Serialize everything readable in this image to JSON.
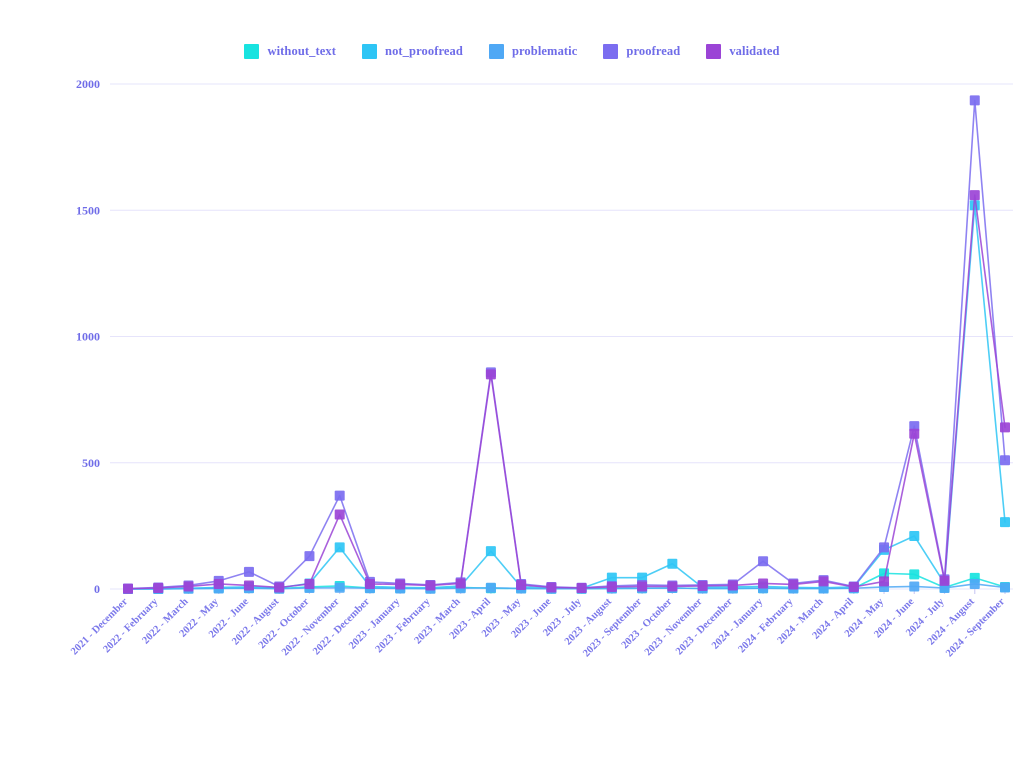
{
  "chart_data": {
    "type": "line",
    "title": "",
    "xlabel": "",
    "ylabel": "",
    "ylim": [
      0,
      2000
    ],
    "yticks": [
      0,
      500,
      1000,
      1500,
      2000
    ],
    "ytick_labels": [
      "0",
      "500",
      "1000",
      "1500",
      "2000"
    ],
    "grid": true,
    "legend_position": "top-center",
    "markers": "square",
    "categories": [
      "2021 - December",
      "2022 - February",
      "2022 - March",
      "2022 - May",
      "2022 - June",
      "2022 - August",
      "2022 - October",
      "2022 - November",
      "2022 - December",
      "2023 - January",
      "2023 - February",
      "2023 - March",
      "2023 - April",
      "2023 - May",
      "2023 - June",
      "2023 - July",
      "2023 - August",
      "2023 - September",
      "2023 - October",
      "2023 - November",
      "2023 - December",
      "2024 - January",
      "2024 - February",
      "2024 - March",
      "2024 - April",
      "2024 - May",
      "2024 - June",
      "2024 - July",
      "2024 - August",
      "2024 - September"
    ],
    "series": [
      {
        "name": "without_text",
        "color": "#18e3e0",
        "values": [
          0,
          0,
          2,
          3,
          4,
          2,
          8,
          12,
          4,
          3,
          2,
          6,
          3,
          2,
          1,
          1,
          2,
          3,
          4,
          2,
          2,
          3,
          2,
          2,
          3,
          62,
          58,
          6,
          44,
          8
        ]
      },
      {
        "name": "not_proofread",
        "color": "#2ec5f5",
        "values": [
          0,
          1,
          3,
          6,
          8,
          5,
          22,
          165,
          10,
          6,
          5,
          12,
          150,
          8,
          4,
          3,
          45,
          45,
          100,
          6,
          8,
          10,
          6,
          5,
          8,
          155,
          210,
          22,
          1520,
          265
        ]
      },
      {
        "name": "problematic",
        "color": "#4fa8f5",
        "values": [
          0,
          0,
          1,
          2,
          3,
          1,
          4,
          5,
          3,
          2,
          1,
          3,
          5,
          2,
          1,
          1,
          2,
          3,
          4,
          2,
          2,
          3,
          2,
          2,
          3,
          8,
          10,
          4,
          20,
          6
        ]
      },
      {
        "name": "proofread",
        "color": "#7b6df0",
        "values": [
          2,
          6,
          14,
          32,
          68,
          10,
          130,
          370,
          28,
          22,
          16,
          26,
          858,
          20,
          8,
          5,
          12,
          16,
          14,
          16,
          18,
          110,
          22,
          35,
          10,
          165,
          645,
          38,
          1935,
          510
        ]
      },
      {
        "name": "validated",
        "color": "#9b44d6",
        "values": [
          1,
          4,
          10,
          20,
          14,
          6,
          20,
          295,
          20,
          18,
          14,
          22,
          850,
          16,
          6,
          4,
          8,
          10,
          10,
          12,
          14,
          22,
          18,
          30,
          8,
          30,
          615,
          32,
          1560,
          640
        ]
      }
    ]
  },
  "legend": {
    "items": [
      {
        "label": "without_text",
        "color": "#18e3e0"
      },
      {
        "label": "not_proofread",
        "color": "#2ec5f5"
      },
      {
        "label": "problematic",
        "color": "#4fa8f5"
      },
      {
        "label": "proofread",
        "color": "#7b6df0"
      },
      {
        "label": "validated",
        "color": "#9b44d6"
      }
    ]
  },
  "theme": {
    "background": "#ffffff",
    "axis_text": "#6f6ce8",
    "gridline": "#e6e4fb"
  }
}
